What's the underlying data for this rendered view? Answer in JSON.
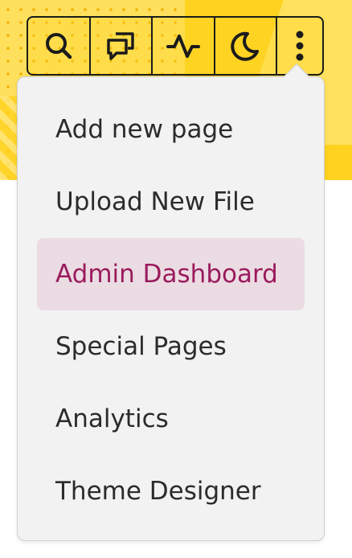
{
  "toolbar": {
    "buttons": [
      {
        "icon": "search-icon"
      },
      {
        "icon": "discussion-icon"
      },
      {
        "icon": "activity-icon"
      },
      {
        "icon": "moon-icon"
      },
      {
        "icon": "more-vertical-icon"
      }
    ]
  },
  "menu": {
    "items": [
      {
        "label": "Add new page"
      },
      {
        "label": "Upload New File"
      },
      {
        "label": "Admin Dashboard",
        "active": true
      },
      {
        "label": "Special Pages"
      },
      {
        "label": "Analytics"
      },
      {
        "label": "Theme Designer"
      }
    ]
  },
  "colors": {
    "banner": "#ffd21f",
    "menu_background": "#f2f2f2",
    "active_background": "#ebdce3",
    "active_text": "#9b1b5c",
    "text": "#2b2b2b"
  }
}
